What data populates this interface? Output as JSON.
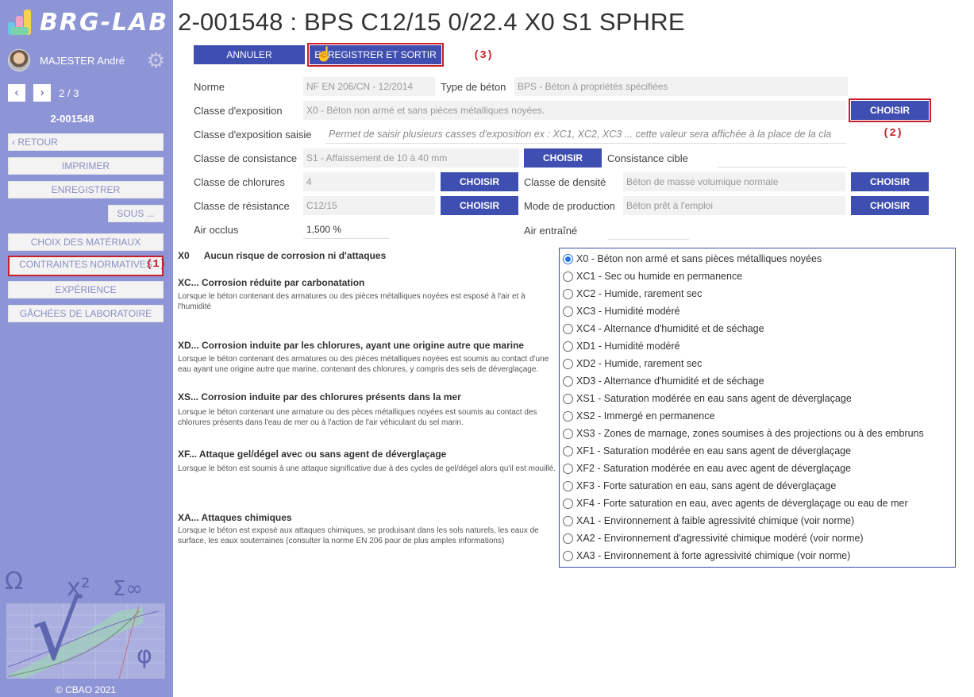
{
  "sidebar": {
    "logo_text": "BRG-LAB",
    "user_name": "MAJESTER André",
    "pager": "2 / 3",
    "record_id": "2-001548",
    "retour": "RETOUR",
    "imprimer": "IMPRIMER",
    "enregistrer": "ENREGISTRER",
    "sous": "SOUS ...",
    "nav": [
      "CHOIX DES MATÉRIAUX",
      "CONTRAINTES NORMATIVES",
      "EXPÉRIENCE",
      "GÂCHÉES DE LABORATOIRE"
    ],
    "annotation": "(1)",
    "math_symbols": [
      "Ω",
      "√",
      "x²",
      "Σ∞",
      "φ"
    ],
    "copyright": "© CBAO 2021"
  },
  "header": {
    "title": "2-001548 : BPS C12/15 0/22.4 X0 S1 SPHRE",
    "annuler": "ANNULER",
    "enregistrer_sortir": "ENREGISTRER ET SORTIR",
    "annotation": "(3)"
  },
  "form": {
    "norme_label": "Norme",
    "norme_value": "NF EN 206/CN  -  12/2014",
    "type_beton_label": "Type de béton",
    "type_beton_value": "BPS - Béton à propriétés spécifiées",
    "classe_expo_label": "Classe d'exposition",
    "classe_expo_value": "X0 - Béton non armé et sans pièces métalliques noyées.",
    "choisir": "CHOISIR",
    "annotation2": "(2)",
    "classe_expo_saisie_label": "Classe d'exposition saisie",
    "classe_expo_saisie_placeholder": "Permet de saisir plusieurs casses d'exposition ex : XC1, XC2, XC3 ... cette valeur sera affichée à la place de la cla",
    "consistance_label": "Classe de consistance",
    "consistance_value": "S1 - Affaissement de 10 à 40 mm",
    "consistance_cible_label": "Consistance cible",
    "chlorures_label": "Classe de chlorures",
    "chlorures_value": "4",
    "densite_label": "Classe de densité",
    "densite_value": "Béton de masse volumique normale",
    "resistance_label": "Classe de résistance",
    "resistance_value": "C12/15",
    "production_label": "Mode de production",
    "production_value": "Béton prêt à l'emploi",
    "air_occlus_label": "Air occlus",
    "air_occlus_value": "1,500 %",
    "air_entraine_label": "Air entraîné"
  },
  "descriptions": {
    "x0_code": "X0",
    "x0_text": "Aucun risque de corrosion ni d'attaques",
    "xc_title": "XC... Corrosion réduite par carbonatation",
    "xc_desc": "Lorsque le béton contenant des armatures ou des pièces métalliques noyées est esposé à l'air et à l'humidité",
    "xd_title": "XD... Corrosion induite par les chlorures, ayant une origine autre que marine",
    "xd_desc": "Lorsque le béton contenant des armatures ou des pièces métalliques noyées est soumis au contact d'une eau ayant une origine autre que marine, contenant des chlorures, y compris des sels de déverglaçage.",
    "xs_title": "XS... Corrosion induite par des chlorures présents dans la mer",
    "xs_desc": "Lorsque le béton contenant une armature ou des pèces métalliques noyées est soumis au contact des chlorures présents dans l'eau de mer ou à l'action de l'air véhiculant du sel marin.",
    "xf_title": "XF... Attaque gel/dégel avec ou sans agent de déverglaçage",
    "xf_desc": "Lorsque le béton est soumis à une attaque significative due à des cycles de gel/dégel alors qu'il est mouillé.",
    "xa_title": "XA... Attaques chimiques",
    "xa_desc": "Lorsque le béton est exposé aux attaques chimiques, se produisant dans les sols naturels, les eaux de surface, les eaux souterraines (consulter la norme EN 206 pour de plus amples informations)"
  },
  "radios": [
    "X0 - Béton non armé et sans pièces métalliques noyées",
    "XC1 - Sec ou humide en permanence",
    "XC2 - Humide, rarement sec",
    "XC3 - Humidité modéré",
    "XC4 - Alternance d'humidité et de séchage",
    "XD1 - Humidité modéré",
    "XD2 - Humide, rarement sec",
    "XD3 - Alternance d'humidité et de séchage",
    "XS1 - Saturation modérée en eau sans agent de déverglaçage",
    "XS2 - Immergé en permanence",
    "XS3 - Zones de marnage, zones soumises à des projections ou à des embruns",
    "XF1 - Saturation modérée en eau sans agent de déverglaçage",
    "XF2 - Saturation modérée en eau avec agent de déverglaçage",
    "XF3 - Forte saturation en eau, sans agent de déverglaçage",
    "XF4 - Forte saturation en eau, avec agents de déverglaçage ou eau de mer",
    "XA1 - Environnement à faible agressivité chimique (voir norme)",
    "XA2 - Environnement d'agressivité chimique modéré (voir norme)",
    "XA3 - Environnement à forte agressivité chimique (voir norme)"
  ],
  "radio_selected": 0
}
